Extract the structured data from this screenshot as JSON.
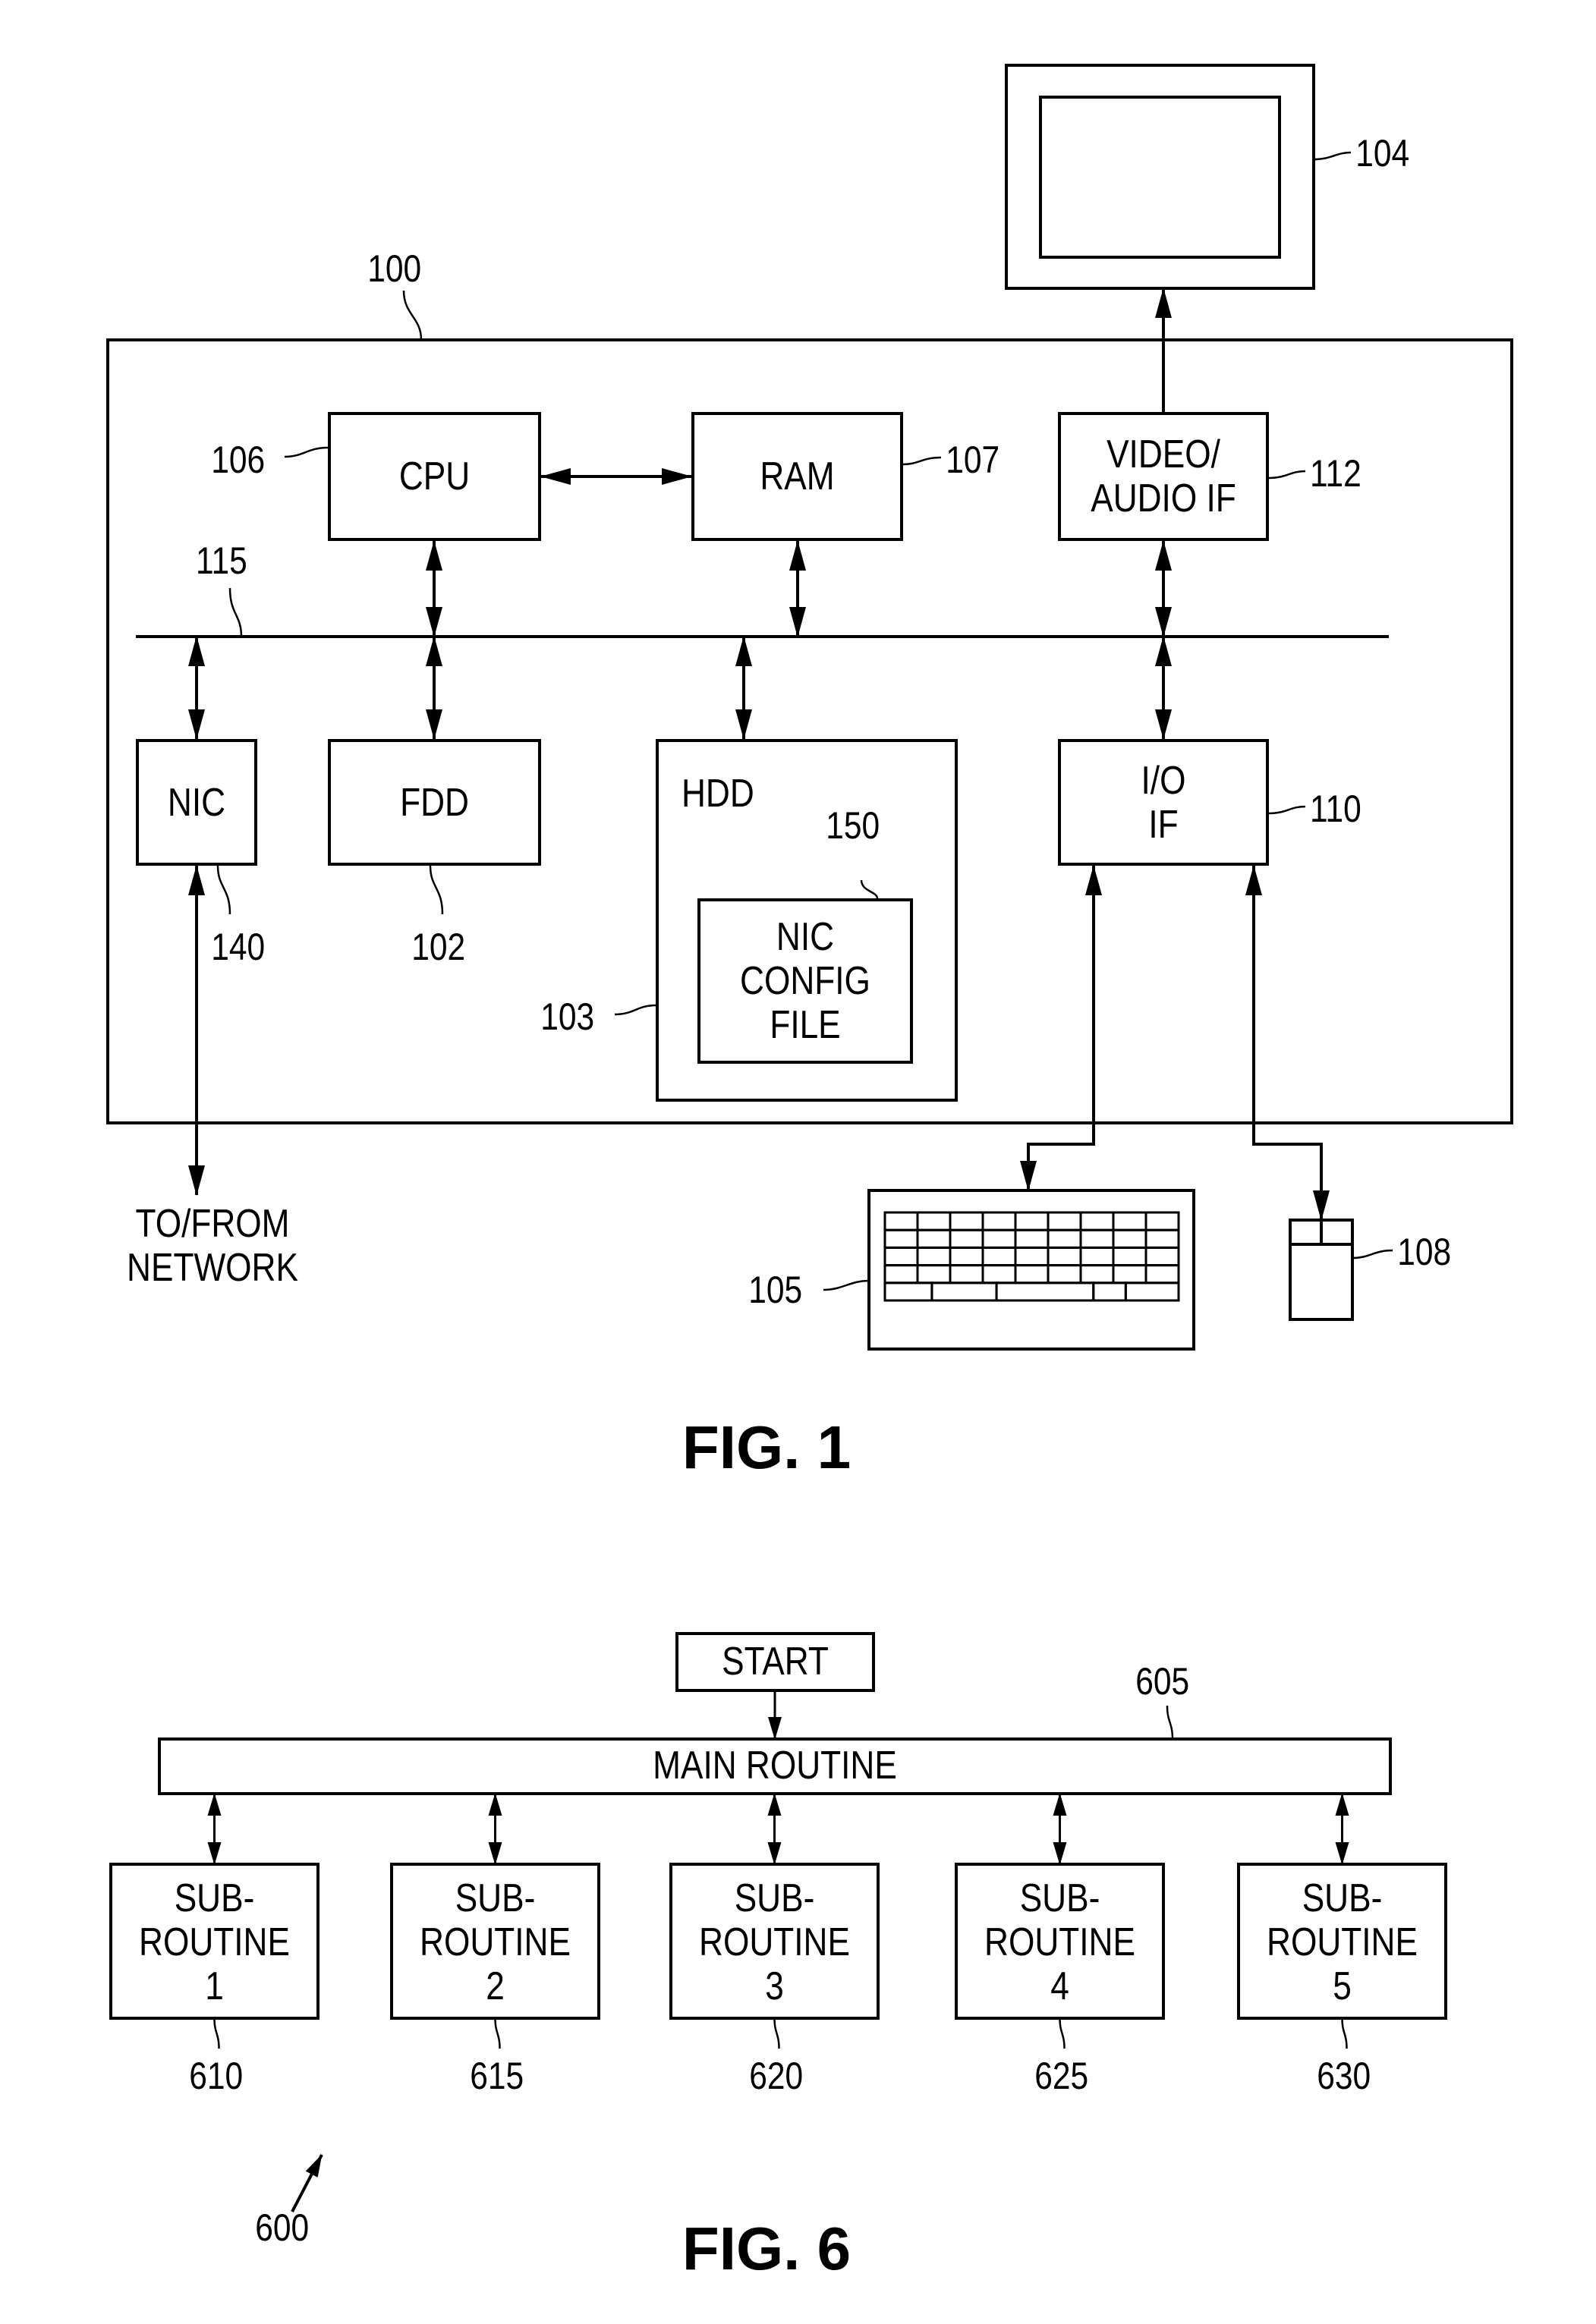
{
  "fig1": {
    "caption": "FIG. 1",
    "system": {
      "ref": "100"
    },
    "bus": {
      "ref": "115"
    },
    "monitor": {
      "ref": "104"
    },
    "cpu": {
      "label": "CPU",
      "ref": "106"
    },
    "ram": {
      "label": "RAM",
      "ref": "107"
    },
    "video_if": {
      "label_line1": "VIDEO/",
      "label_line2": "AUDIO IF",
      "ref": "112"
    },
    "nic": {
      "label": "NIC",
      "ref": "140"
    },
    "fdd": {
      "label": "FDD",
      "ref": "102"
    },
    "hdd": {
      "label": "HDD",
      "ref": "103"
    },
    "nic_config": {
      "label_line1": "NIC",
      "label_line2": "CONFIG",
      "label_line3": "FILE",
      "ref": "150"
    },
    "io_if": {
      "label_line1": "I/O",
      "label_line2": "IF",
      "ref": "110"
    },
    "keyboard": {
      "ref": "105"
    },
    "mouse": {
      "ref": "108"
    },
    "network": {
      "label_line1": "TO/FROM",
      "label_line2": "NETWORK"
    }
  },
  "fig6": {
    "caption": "FIG. 6",
    "diagram_ref": "600",
    "start": {
      "label": "START"
    },
    "main_routine": {
      "label": "MAIN ROUTINE",
      "ref": "605"
    },
    "subroutines": [
      {
        "line1": "SUB-",
        "line2": "ROUTINE",
        "line3": "1",
        "ref": "610"
      },
      {
        "line1": "SUB-",
        "line2": "ROUTINE",
        "line3": "2",
        "ref": "615"
      },
      {
        "line1": "SUB-",
        "line2": "ROUTINE",
        "line3": "3",
        "ref": "620"
      },
      {
        "line1": "SUB-",
        "line2": "ROUTINE",
        "line3": "4",
        "ref": "625"
      },
      {
        "line1": "SUB-",
        "line2": "ROUTINE",
        "line3": "5",
        "ref": "630"
      }
    ]
  }
}
